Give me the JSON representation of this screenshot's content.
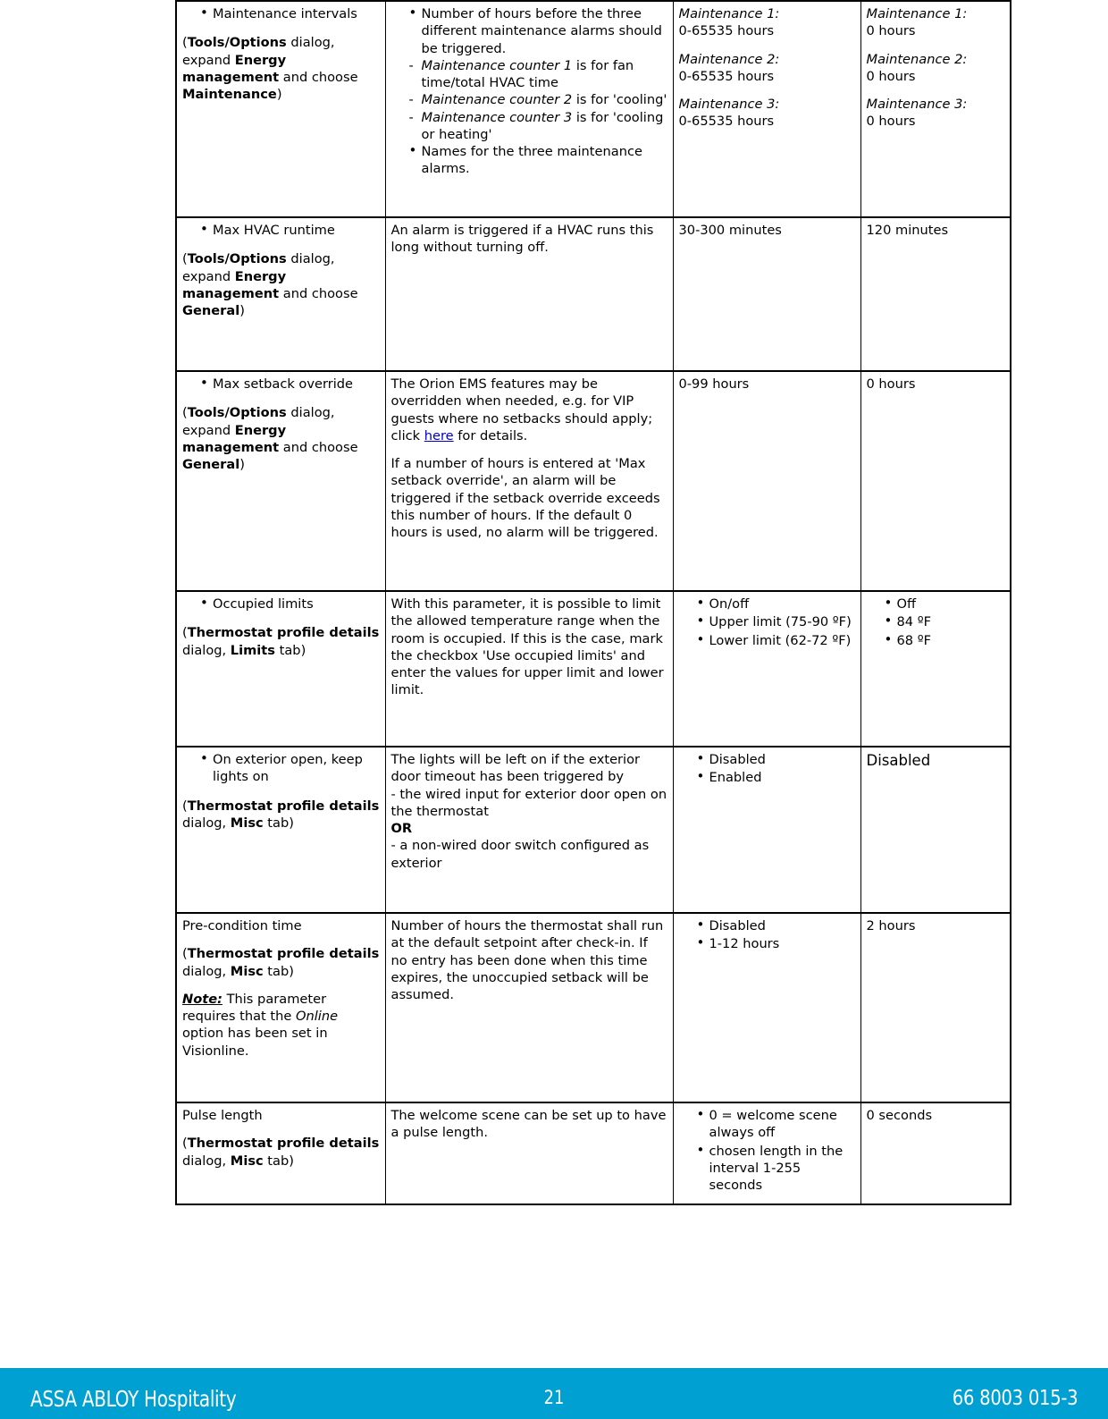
{
  "document": {
    "table_rows": [
      {
        "id": "maintenance-intervals",
        "parameter": {
          "bullet": "Maintenance intervals",
          "location_pre": "(",
          "location_b1": "Tools/Options",
          "location_t1": " dialog, expand ",
          "location_b2": "Energy management",
          "location_t2": " and choose ",
          "location_b3": "Maintenance",
          "location_post": ")"
        },
        "description": {
          "bullet1": "Number of hours before the three different maintenance alarms should be triggered.",
          "dash1_i": "Maintenance counter 1",
          "dash1_t": " is for fan time/total HVAC time",
          "dash2_i": "Maintenance counter 2",
          "dash2_t": " is for 'cooling'",
          "dash3_i": "Maintenance counter 3",
          "dash3_t": " is for 'cooling or heating'",
          "bullet2": "Names for the three maintenance alarms."
        },
        "range": {
          "label1": "Maintenance 1:",
          "value1": "0-65535 hours",
          "label2": "Maintenance 2:",
          "value2": "0-65535 hours",
          "label3": "Maintenance 3:",
          "value3": "0-65535 hours"
        },
        "default": {
          "label1": "Maintenance 1:",
          "value1": "0 hours",
          "label2": "Maintenance 2:",
          "value2": "0 hours",
          "label3": "Maintenance 3:",
          "value3": "0 hours"
        }
      },
      {
        "id": "max-hvac-runtime",
        "parameter": {
          "bullet": "Max HVAC runtime",
          "location_pre": "(",
          "location_b1": "Tools/Options",
          "location_t1": " dialog, expand ",
          "location_b2": "Energy management",
          "location_t2": " and choose ",
          "location_b3": "General",
          "location_post": ")"
        },
        "description": {
          "text": "An alarm is triggered if a HVAC runs this long without turning off."
        },
        "range": {
          "text": "30-300 minutes"
        },
        "default": {
          "text": "120 minutes"
        }
      },
      {
        "id": "max-setback-override",
        "parameter": {
          "bullet": "Max setback override",
          "location_pre": "(",
          "location_b1": "Tools/Options",
          "location_t1": " dialog, expand ",
          "location_b2": "Energy management",
          "location_t2": " and choose ",
          "location_b3": "General",
          "location_post": ")"
        },
        "description": {
          "para1_a": "The Orion EMS features may be overridden when needed, e.g. for VIP guests where no setbacks should apply; click ",
          "link": "here",
          "para1_b": " for details.",
          "para2": "If a number of hours is entered at 'Max setback override', an alarm will be triggered if the setback override exceeds this number of hours. If the default 0 hours is used, no alarm will be triggered."
        },
        "range": {
          "text": "0-99 hours"
        },
        "default": {
          "text": "0 hours"
        }
      },
      {
        "id": "occupied-limits",
        "parameter": {
          "bullet": "Occupied limits",
          "location_pre": "(",
          "location_b1": "Thermostat profile details",
          "location_t1": " dialog, ",
          "location_b2": "Limits",
          "location_t2": " tab",
          "location_post": ")"
        },
        "description": {
          "text": "With this parameter, it is possible to limit the allowed temperature range when the room is occupied. If this is the case, mark the checkbox 'Use occupied limits' and enter the values for upper limit and lower limit."
        },
        "range": {
          "items": [
            "On/off",
            "Upper limit (75-90 ºF)",
            "Lower limit (62-72 ºF)"
          ]
        },
        "default": {
          "items": [
            "Off",
            "84 ºF",
            "68 ºF"
          ]
        }
      },
      {
        "id": "on-exterior-open-keep-lights-on",
        "parameter": {
          "bullet": "On exterior open, keep lights on",
          "location_pre": "(",
          "location_b1": "Thermostat profile details",
          "location_t1": " dialog, ",
          "location_b2": "Misc",
          "location_t2": " tab",
          "location_post": ")"
        },
        "description": {
          "line1": "The lights will be left on if the exterior door timeout has been triggered by",
          "line2": "- the wired input for exterior door open on the thermostat",
          "line3_b": "OR",
          "line4": "- a non-wired door switch configured as exterior"
        },
        "range": {
          "items": [
            "Disabled",
            "Enabled"
          ]
        },
        "default": {
          "text": "Disabled"
        }
      },
      {
        "id": "pre-condition-time",
        "parameter": {
          "plain": "Pre-condition time",
          "location_pre": "(",
          "location_b1": "Thermostat profile details",
          "location_t1": " dialog, ",
          "location_b2": "Misc",
          "location_t2": " tab",
          "location_post": ")",
          "note_label": "Note:",
          "note_a": " This parameter requires that the ",
          "note_i": "Online",
          "note_b": " option has  been set in Visionline."
        },
        "description": {
          "text": "Number of hours the thermostat shall run at the default setpoint after check-in. If no entry has been done when this time expires, the unoccupied setback will be assumed."
        },
        "range": {
          "items": [
            "Disabled",
            "1-12 hours"
          ]
        },
        "default": {
          "text": "2 hours"
        }
      },
      {
        "id": "pulse-length",
        "parameter": {
          "plain": "Pulse length",
          "location_pre": "(",
          "location_b1": "Thermostat profile details",
          "location_t1": " dialog, ",
          "location_b2": "Misc",
          "location_t2": " tab",
          "location_post": ")"
        },
        "description": {
          "text": "The welcome scene can be set up to have a pulse length."
        },
        "range": {
          "items": [
            "0 = welcome scene always off",
            "chosen length in the interval 1-255 seconds"
          ]
        },
        "default": {
          "text": "0 seconds"
        }
      }
    ]
  },
  "footer": {
    "brand": "ASSA ABLOY Hospitality",
    "page_number": "21",
    "doc_code": "66 8003 015-3",
    "background_color": "#00a0d2",
    "text_color": "#ffffff"
  }
}
